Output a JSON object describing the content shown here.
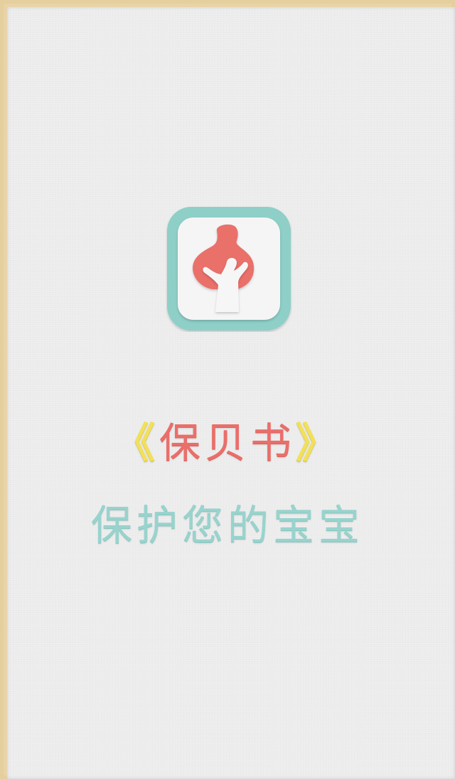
{
  "app": {
    "logo_icon": "mother-holding-baby-icon",
    "title": "保贝书",
    "title_left_bracket": "《",
    "title_right_bracket": "》",
    "slogan": "保护您的宝宝"
  },
  "colors": {
    "background": "#efeeee",
    "frame": "#e6cf9f",
    "logo_frame": "#8ecfc8",
    "logo_inner": "#f5f5f5",
    "logo_figure": "#ea6f6a",
    "bracket": "#f2df5a",
    "title": "#ea6f6a",
    "slogan": "#99d3cd"
  }
}
